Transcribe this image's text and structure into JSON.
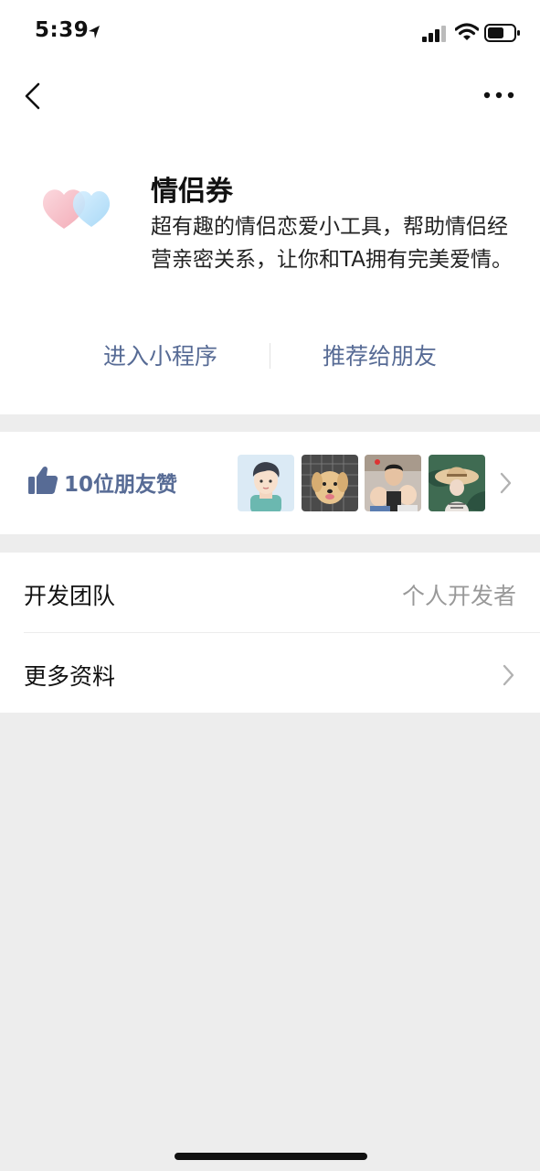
{
  "status_bar": {
    "time": "5:39"
  },
  "nav": {
    "back_icon": "chevron-left-icon",
    "more_icon": "more-dots-icon"
  },
  "app": {
    "name": "情侣券",
    "description": "超有趣的情侣恋爱小工具，帮助情侣经营亲密关系，让你和TA拥有完美爱情。",
    "logo_icon": "hearts-icon"
  },
  "actions": {
    "enter_label": "进入小程序",
    "recommend_label": "推荐给朋友"
  },
  "likes": {
    "text": "10位朋友赞",
    "icon": "thumbs-up-icon",
    "avatars": [
      "cartoon-boy-avatar",
      "puppy-avatar",
      "family-avatar",
      "hat-avatar"
    ]
  },
  "info": {
    "developer_label": "开发团队",
    "developer_value": "个人开发者",
    "more_label": "更多资料"
  },
  "colors": {
    "link": "#576b95",
    "background": "#ededed",
    "card": "#ffffff",
    "secondary_text": "#999999"
  }
}
